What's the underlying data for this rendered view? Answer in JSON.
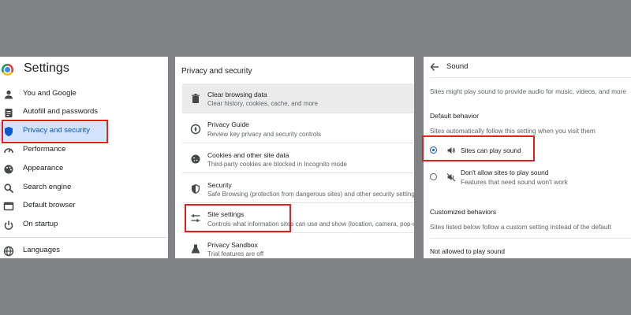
{
  "panel1": {
    "title": "Settings",
    "nav": [
      {
        "label": "You and Google",
        "icon": "person-icon"
      },
      {
        "label": "Autofill and passwords",
        "icon": "clipboard-icon"
      },
      {
        "label": "Privacy and security",
        "icon": "shield-icon",
        "active": true
      },
      {
        "label": "Performance",
        "icon": "speedometer-icon"
      },
      {
        "label": "Appearance",
        "icon": "palette-icon"
      },
      {
        "label": "Search engine",
        "icon": "search-icon"
      },
      {
        "label": "Default browser",
        "icon": "browser-icon"
      },
      {
        "label": "On startup",
        "icon": "power-icon"
      },
      {
        "label": "Languages",
        "icon": "globe-icon"
      }
    ]
  },
  "panel2": {
    "heading": "Privacy and security",
    "rows": [
      {
        "title": "Clear browsing data",
        "sub": "Clear history, cookies, cache, and more",
        "icon": "trash-icon"
      },
      {
        "title": "Privacy Guide",
        "sub": "Review key privacy and security controls",
        "icon": "compass-icon"
      },
      {
        "title": "Cookies and other site data",
        "sub": "Third-party cookies are blocked in Incognito mode",
        "icon": "cookie-icon"
      },
      {
        "title": "Security",
        "sub": "Safe Browsing (protection from dangerous sites) and other security settings",
        "icon": "shield-icon"
      },
      {
        "title": "Site settings",
        "sub": "Controls what information sites can use and show (location, camera, pop-ups, and more)",
        "icon": "sliders-icon"
      },
      {
        "title": "Privacy Sandbox",
        "sub": "Trial features are off",
        "icon": "flask-icon"
      }
    ]
  },
  "panel3": {
    "title": "Sound",
    "description": "Sites might play sound to provide audio for music, videos, and more",
    "default_heading": "Default behavior",
    "default_sub": "Sites automatically follow this setting when you visit them",
    "options": [
      {
        "label": "Sites can play sound",
        "sub": "",
        "selected": true,
        "icon": "speaker-icon"
      },
      {
        "label": "Don't allow sites to play sound",
        "sub": "Features that need sound won't work",
        "selected": false,
        "icon": "speaker-muted-icon"
      }
    ],
    "custom_heading": "Customized behaviors",
    "custom_sub": "Sites listed below follow a custom setting instead of the default",
    "not_allowed_label": "Not allowed to play sound"
  },
  "colors": {
    "background": "#808285",
    "highlight_box": "#e0201c",
    "accent": "#0b57d0",
    "active_nav_bg": "#d3e3fd"
  }
}
